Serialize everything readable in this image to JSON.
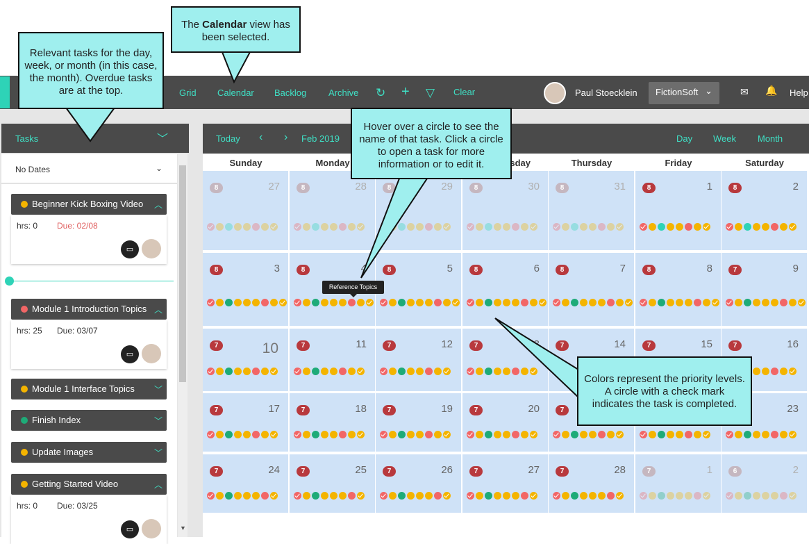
{
  "topbar": {
    "nav": [
      "Grid",
      "Calendar",
      "Backlog",
      "Archive"
    ],
    "clear": "Clear",
    "user": "Paul Stoecklein",
    "company": "FictionSoft",
    "help": "Help"
  },
  "sidebar": {
    "title": "Tasks",
    "filter": "No Dates",
    "tasks": [
      {
        "name": "Beginner Kick Boxing Video",
        "color": "#f4b400",
        "expanded": true,
        "hrs": "hrs: 0",
        "due": "Due: 02/08",
        "overdue": true
      },
      {
        "name": "Module 1 Introduction Topics",
        "color": "#f26666",
        "expanded": true,
        "hrs": "hrs: 25",
        "due": "Due: 03/07",
        "overdue": false
      },
      {
        "name": "Module 1 Interface Topics",
        "color": "#f4b400",
        "expanded": false
      },
      {
        "name": "Finish Index",
        "color": "#1eab78",
        "expanded": false
      },
      {
        "name": "Update Images",
        "color": "#f4b400",
        "expanded": false
      },
      {
        "name": "Getting Started Video",
        "color": "#f4b400",
        "expanded": true,
        "hrs": "hrs: 0",
        "due": "Due: 03/25",
        "overdue": false
      }
    ]
  },
  "calendar": {
    "today": "Today",
    "month_label": "Feb 2019",
    "views": [
      "Day",
      "Week",
      "Month"
    ],
    "weekdays": [
      "Sunday",
      "Monday",
      "Tuesday",
      "Wednesday",
      "Thursday",
      "Friday",
      "Saturday"
    ],
    "weeks": [
      [
        {
          "d": "27",
          "b": "8",
          "f": true
        },
        {
          "d": "28",
          "b": "8",
          "f": true
        },
        {
          "d": "29",
          "b": "8",
          "f": true
        },
        {
          "d": "30",
          "b": "8",
          "f": true
        },
        {
          "d": "31",
          "b": "8",
          "f": true
        },
        {
          "d": "1",
          "b": "8"
        },
        {
          "d": "2",
          "b": "8"
        }
      ],
      [
        {
          "d": "3",
          "b": "8"
        },
        {
          "d": "4",
          "b": "8"
        },
        {
          "d": "5",
          "b": "8"
        },
        {
          "d": "6",
          "b": "8"
        },
        {
          "d": "7",
          "b": "8"
        },
        {
          "d": "8",
          "b": "8"
        },
        {
          "d": "9",
          "b": "7"
        }
      ],
      [
        {
          "d": "10",
          "b": "7",
          "today": true
        },
        {
          "d": "11",
          "b": "7"
        },
        {
          "d": "12",
          "b": "7"
        },
        {
          "d": "13",
          "b": "7"
        },
        {
          "d": "14",
          "b": "7"
        },
        {
          "d": "15",
          "b": "7"
        },
        {
          "d": "16",
          "b": "7"
        }
      ],
      [
        {
          "d": "17",
          "b": "7"
        },
        {
          "d": "18",
          "b": "7"
        },
        {
          "d": "19",
          "b": "7"
        },
        {
          "d": "20",
          "b": "7"
        },
        {
          "d": "21",
          "b": "7"
        },
        {
          "d": "22",
          "b": "7"
        },
        {
          "d": "23",
          "b": "7"
        }
      ],
      [
        {
          "d": "24",
          "b": "7"
        },
        {
          "d": "25",
          "b": "7"
        },
        {
          "d": "26",
          "b": "7"
        },
        {
          "d": "27",
          "b": "7"
        },
        {
          "d": "28",
          "b": "7"
        },
        {
          "d": "1",
          "b": "7",
          "f": true
        },
        {
          "d": "2",
          "b": "6",
          "f": true
        }
      ]
    ],
    "tooltip": "Reference Topics"
  },
  "colors": {
    "red": "#f26666",
    "yellow": "#f4b400",
    "green": "#1eab78",
    "teal": "#2ed3b7",
    "accent": "#3fe0c5"
  },
  "callouts": {
    "tasks_html": "Relevant tasks for the day, week, or month (in this case, the month). Overdue tasks are at the top.",
    "calendar_html": "The <b>Calendar</b> view has been selected.",
    "hover_html": "Hover over a circle to see the name of that task. Click a circle to open a task for more information or to edit it.",
    "colors_html": "Colors represent the priority levels. A circle with a check mark indicates the task is completed."
  }
}
